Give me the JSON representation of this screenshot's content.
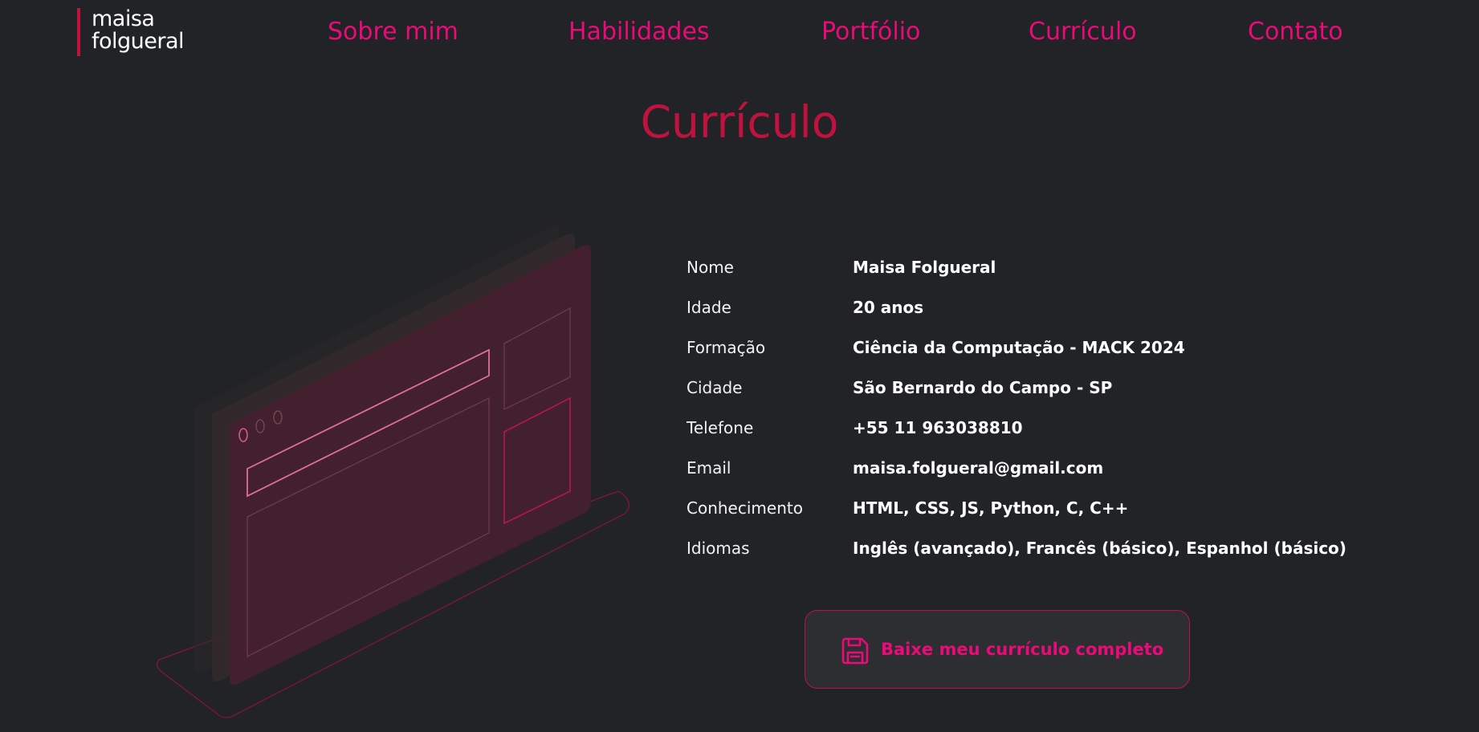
{
  "brand": {
    "line1": "maisa",
    "line2": "folgueral",
    "accent_color": "#c0123f"
  },
  "nav": {
    "items": [
      {
        "label": "Sobre mim"
      },
      {
        "label": "Habilidades"
      },
      {
        "label": "Portfólio"
      },
      {
        "label": "Currículo"
      },
      {
        "label": "Contato"
      }
    ],
    "color": "#ea0a78"
  },
  "section": {
    "title": "Currículo"
  },
  "resume": {
    "rows": [
      {
        "label": "Nome",
        "value": "Maisa Folgueral"
      },
      {
        "label": "Idade",
        "value": "20 anos"
      },
      {
        "label": "Formação",
        "value": "Ciência da Computação - MACK 2024"
      },
      {
        "label": "Cidade",
        "value": "São Bernardo do Campo - SP"
      },
      {
        "label": "Telefone",
        "value": "+55 11 963038810"
      },
      {
        "label": "Email",
        "value": "maisa.folgueral@gmail.com"
      },
      {
        "label": "Conhecimento",
        "value": "HTML, CSS, JS, Python, C, C++"
      },
      {
        "label": "Idiomas",
        "value": "Inglês (avançado), Francês (básico), Espanhol (básico)"
      }
    ]
  },
  "download": {
    "label": "Baixe meu currículo completo",
    "icon": "floppy-disk-icon"
  },
  "illustration": {
    "icon": "browser-window-illustration"
  },
  "colors": {
    "background": "#222326",
    "primary": "#ea0a78",
    "title": "#c0123f",
    "text": "#ffffff"
  }
}
